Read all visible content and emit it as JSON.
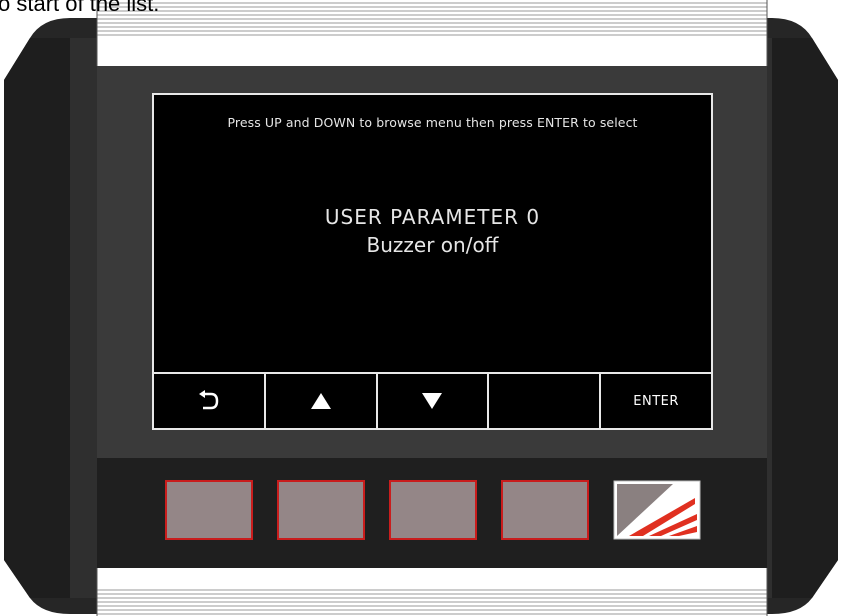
{
  "caption": "o start of the list.",
  "screen": {
    "instruction": "Press UP and DOWN to browse menu then press ENTER to select",
    "param_title": "USER PARAMETER 0",
    "param_desc": "Buzzer on/off"
  },
  "softkeys": [
    {
      "icon": "back-arrow-icon",
      "label": ""
    },
    {
      "icon": "up-triangle-icon",
      "label": ""
    },
    {
      "icon": "down-triangle-icon",
      "label": ""
    },
    {
      "icon": "",
      "label": ""
    },
    {
      "icon": "",
      "label": "ENTER"
    }
  ],
  "hardware_buttons": [
    "button-1",
    "button-2",
    "button-3",
    "button-4"
  ],
  "colors": {
    "body": "#2a2a2a",
    "screen": "#000000",
    "button_fill": "#948687",
    "button_border": "#c91d1d",
    "logo_red": "#e03020"
  }
}
